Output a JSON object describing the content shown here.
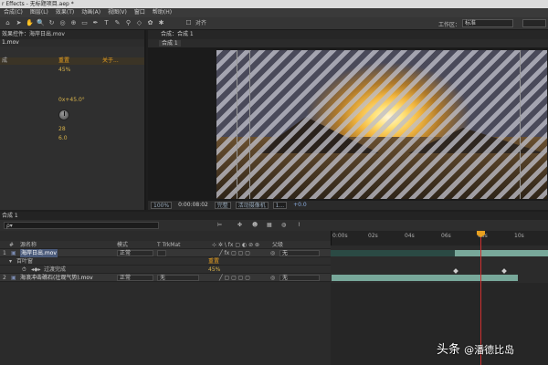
{
  "window": {
    "title": "r Effects - 无标题项目.aep *"
  },
  "menu": [
    "合成(C)",
    "图层(L)",
    "效果(T)",
    "动画(A)",
    "视图(V)",
    "窗口",
    "帮助(H)"
  ],
  "toolbar": {
    "snap_label": "对齐",
    "workspace_label": "工作区：",
    "workspace_value": "标准"
  },
  "effects_panel": {
    "tab": "效果控件：海岸日出.mov",
    "sublabel": "1.mov",
    "rows": [
      {
        "label": "成",
        "value": "重置",
        "extra": "关于..."
      },
      {
        "label": "",
        "value": "45%"
      },
      {
        "label": "",
        "value": "0x+45.0°"
      },
      {
        "label": "",
        "value": "28"
      },
      {
        "label": "",
        "value": "6.0"
      }
    ]
  },
  "comp_panel": {
    "tab": "合成：合成 1",
    "subtab": "合成 1",
    "bottom": {
      "zoom": "100%",
      "timecode": "0:00:08:02",
      "resolution": "完整",
      "camera": "活动摄像机",
      "views": "1...",
      "exposure": "+0.0"
    },
    "guide_positions": [
      "x1",
      "x2",
      "x3"
    ]
  },
  "timeline": {
    "tab": "合成 1",
    "search_placeholder": "ρ▾",
    "ruler_ticks": [
      "0:00s",
      "02s",
      "04s",
      "06s",
      "08s",
      "10s"
    ],
    "headers": {
      "num": "#",
      "name": "源名称",
      "mode": "模式",
      "trkmat": "T TrkMat",
      "parent": "父级"
    },
    "layers": [
      {
        "num": "1",
        "name": "海岸日出.mov",
        "mode": "正常",
        "trkmat": "",
        "parent": "无"
      },
      {
        "name": "百叶窗",
        "value": "重置"
      },
      {
        "name": "过渡完成",
        "value": "45%"
      },
      {
        "num": "2",
        "name": "海浪冲击礁石(壮观气势).mov",
        "mode": "正常",
        "trkmat": "无",
        "parent": "无"
      }
    ]
  },
  "watermark": {
    "brand": "头条",
    "handle": "@潘德比岛"
  }
}
